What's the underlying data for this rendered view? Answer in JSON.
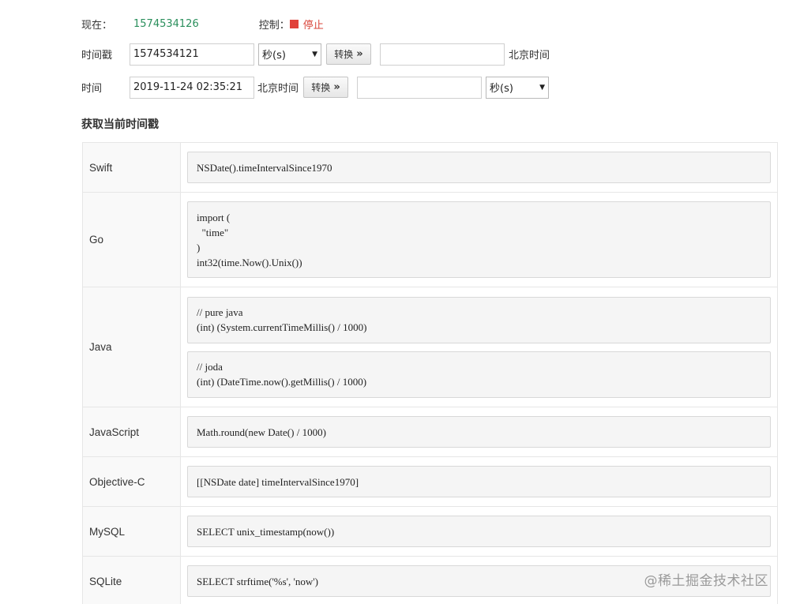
{
  "status": {
    "now_label": "现在：",
    "now_value": "1574534126",
    "control_label": "控制：",
    "stop_label": "停止"
  },
  "timestamp_row": {
    "label": "时间戳",
    "input_value": "1574534121",
    "unit_select": "秒(s)",
    "convert_label": "转换",
    "output_value": "",
    "output_suffix": "北京时间"
  },
  "time_row": {
    "label": "时间",
    "input_value": "2019-11-24 02:35:21",
    "tz_label": "北京时间",
    "convert_label": "转换",
    "output_value": "",
    "unit_select": "秒(s)"
  },
  "section_title": "获取当前时间戳",
  "languages": [
    {
      "name": "Swift",
      "snippets": [
        "NSDate().timeIntervalSince1970"
      ]
    },
    {
      "name": "Go",
      "snippets": [
        "import (\n  \"time\"\n)\nint32(time.Now().Unix())"
      ]
    },
    {
      "name": "Java",
      "snippets": [
        "// pure java\n(int) (System.currentTimeMillis() / 1000)",
        "// joda\n(int) (DateTime.now().getMillis() / 1000)"
      ]
    },
    {
      "name": "JavaScript",
      "snippets": [
        "Math.round(new Date() / 1000)"
      ]
    },
    {
      "name": "Objective-C",
      "snippets": [
        "[[NSDate date] timeIntervalSince1970]"
      ]
    },
    {
      "name": "MySQL",
      "snippets": [
        "SELECT unix_timestamp(now())"
      ]
    },
    {
      "name": "SQLite",
      "snippets": [
        "SELECT strftime('%s', 'now')"
      ]
    }
  ],
  "watermark": "@稀土掘金技术社区"
}
